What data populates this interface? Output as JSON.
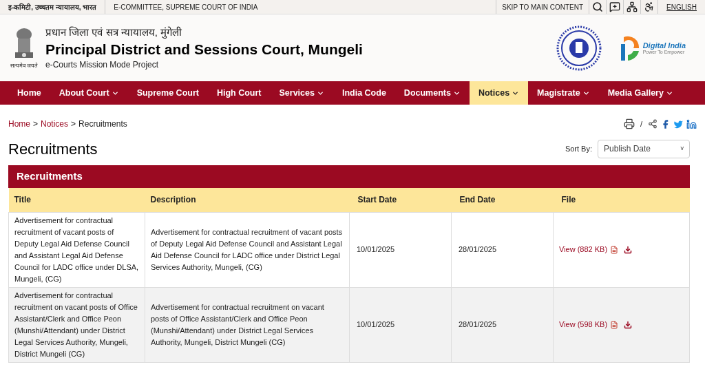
{
  "top_bar": {
    "left": [
      "इ-कमिटी, उच्चतम न्यायालय, भारत",
      "E-COMMITTEE, SUPREME COURT OF INDIA"
    ],
    "skip_link": "SKIP TO MAIN CONTENT",
    "language": "ENGLISH"
  },
  "header": {
    "hindi_title": "प्रधान जिला एवं सत्र न्यायालय, मुंगेली",
    "title": "Principal District and Sessions Court, Mungeli",
    "subtitle": "e-Courts Mission Mode Project",
    "emblem_motto": "सत्यमेव जयते",
    "digital_india": {
      "name": "Digital India",
      "tagline": "Power To Empower"
    }
  },
  "nav": [
    {
      "label": "Home",
      "dropdown": false,
      "selected": false
    },
    {
      "label": "About Court",
      "dropdown": true,
      "selected": false
    },
    {
      "label": "Supreme Court",
      "dropdown": false,
      "selected": false
    },
    {
      "label": "High Court",
      "dropdown": false,
      "selected": false
    },
    {
      "label": "Services",
      "dropdown": true,
      "selected": false
    },
    {
      "label": "India Code",
      "dropdown": false,
      "selected": false
    },
    {
      "label": "Documents",
      "dropdown": true,
      "selected": false
    },
    {
      "label": "Notices",
      "dropdown": true,
      "selected": true
    },
    {
      "label": "Magistrate",
      "dropdown": true,
      "selected": false
    },
    {
      "label": "Media Gallery",
      "dropdown": true,
      "selected": false
    }
  ],
  "breadcrumb": [
    "Home",
    "Notices",
    "Recruitments"
  ],
  "breadcrumb_separators": [
    ">",
    ">"
  ],
  "share_separator": "/",
  "page_title": "Recruitments",
  "sort": {
    "label": "Sort By:",
    "value": "Publish Date",
    "caret": "v"
  },
  "table": {
    "title": "Recruitments",
    "columns": [
      "Title",
      "Description",
      "Start Date",
      "End Date",
      "File"
    ],
    "rows": [
      {
        "title": "Advertisement for contractual recruitment of vacant posts of Deputy Legal Aid Defense Council and Assistant Legal Aid Defense Council for LADC office under DLSA, Mungeli, (CG)",
        "description": "Advertisement for contractual recruitment of vacant posts of Deputy Legal Aid Defense Council and Assistant Legal Aid Defense Council for LADC office under District Legal Services Authority, Mungeli, (CG)",
        "start_date": "10/01/2025",
        "end_date": "28/01/2025",
        "file": "View (882 KB)"
      },
      {
        "title": "Advertisement for contractual recruitment on vacant posts of Office Assistant/Clerk and Office Peon (Munshi/Attendant) under District Legal Services Authority, Mungeli, District Mungeli (CG)",
        "description": "Advertisement for contractual recruitment on vacant posts of Office Assistant/Clerk and Office Peon (Munshi/Attendant) under District Legal Services Authority, Mungeli, District Mungeli (CG)",
        "start_date": "10/01/2025",
        "end_date": "28/01/2025",
        "file": "View (598 KB)"
      }
    ]
  }
}
